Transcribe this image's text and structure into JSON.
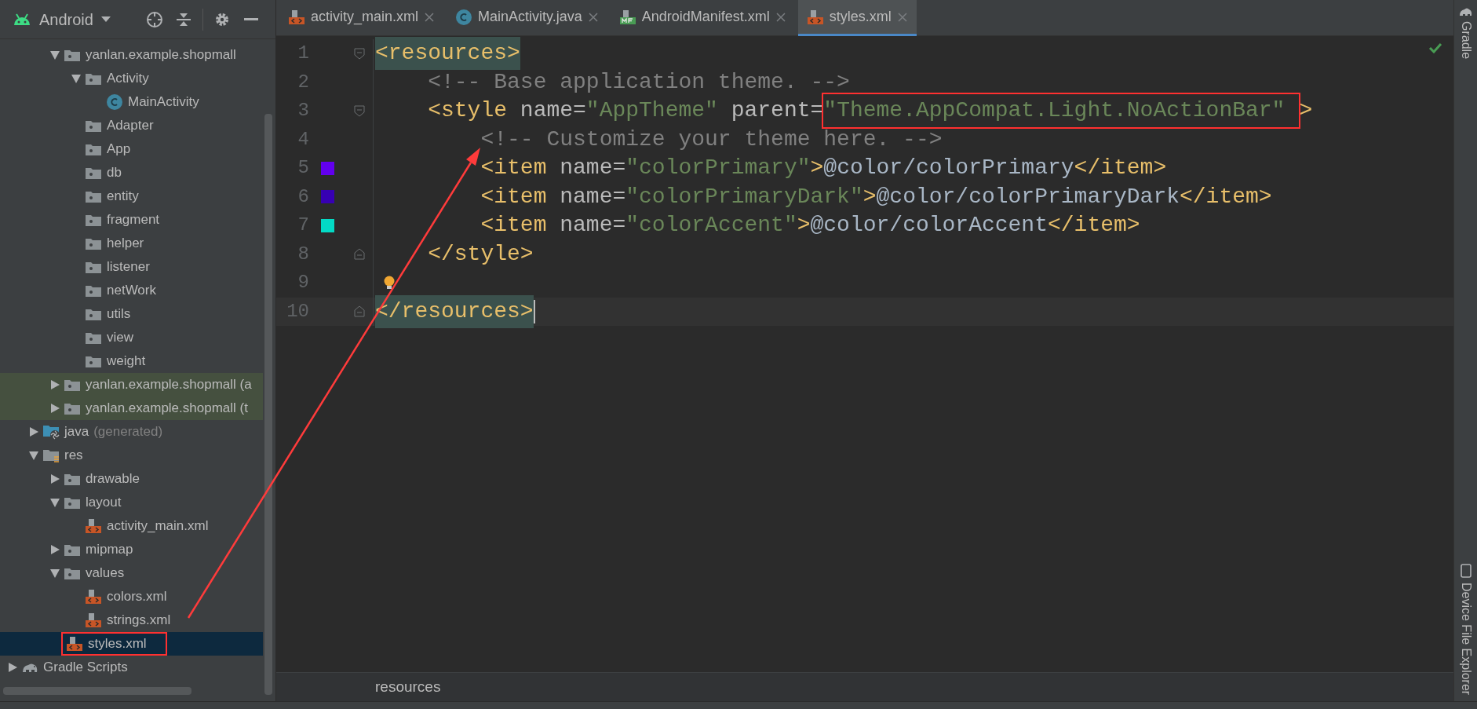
{
  "project_view": {
    "title": "Android"
  },
  "tree": [
    {
      "children": [
        {
          "children": [
            {
              "label": "yanlan.example.shopmall",
              "kind": "package",
              "expanded": true,
              "selected": false,
              "highlighted": false,
              "boxed": false,
              "children": [
                {
                  "label": "Activity",
                  "kind": "package",
                  "expanded": true,
                  "selected": false,
                  "highlighted": false,
                  "boxed": false,
                  "children": [
                    {
                      "label": "MainActivity",
                      "kind": "class",
                      "selected": false,
                      "highlighted": false,
                      "boxed": false
                    }
                  ]
                },
                {
                  "label": "Adapter",
                  "kind": "package",
                  "selected": false,
                  "highlighted": false,
                  "boxed": false
                },
                {
                  "label": "App",
                  "kind": "package",
                  "selected": false,
                  "highlighted": false,
                  "boxed": false
                },
                {
                  "label": "db",
                  "kind": "package",
                  "selected": false,
                  "highlighted": false,
                  "boxed": false
                },
                {
                  "label": "entity",
                  "kind": "package",
                  "selected": false,
                  "highlighted": false,
                  "boxed": false
                },
                {
                  "label": "fragment",
                  "kind": "package",
                  "selected": false,
                  "highlighted": false,
                  "boxed": false
                },
                {
                  "label": "helper",
                  "kind": "package",
                  "selected": false,
                  "highlighted": false,
                  "boxed": false
                },
                {
                  "label": "listener",
                  "kind": "package",
                  "selected": false,
                  "highlighted": false,
                  "boxed": false
                },
                {
                  "label": "netWork",
                  "kind": "package",
                  "selected": false,
                  "highlighted": false,
                  "boxed": false
                },
                {
                  "label": "utils",
                  "kind": "package",
                  "selected": false,
                  "highlighted": false,
                  "boxed": false
                },
                {
                  "label": "view",
                  "kind": "package",
                  "selected": false,
                  "highlighted": false,
                  "boxed": false
                },
                {
                  "label": "weight",
                  "kind": "package",
                  "selected": false,
                  "highlighted": false,
                  "boxed": false
                }
              ]
            },
            {
              "label": "yanlan.example.shopmall (a",
              "kind": "package",
              "expanded": false,
              "selected": false,
              "highlighted": true,
              "boxed": false
            },
            {
              "label": "yanlan.example.shopmall (t",
              "kind": "package",
              "expanded": false,
              "selected": false,
              "highlighted": true,
              "boxed": false
            }
          ]
        },
        {
          "label": "java",
          "suffix": "(generated)",
          "kind": "generated",
          "expanded": false,
          "selected": false,
          "highlighted": false,
          "boxed": false
        },
        {
          "label": "res",
          "kind": "resources",
          "expanded": true,
          "selected": false,
          "highlighted": false,
          "boxed": false,
          "children": [
            {
              "label": "drawable",
              "kind": "package",
              "expanded": false,
              "selected": false,
              "highlighted": false,
              "boxed": false
            },
            {
              "label": "layout",
              "kind": "package",
              "expanded": true,
              "selected": false,
              "highlighted": false,
              "boxed": false,
              "children": [
                {
                  "label": "activity_main.xml",
                  "kind": "xml",
                  "selected": false,
                  "highlighted": false,
                  "boxed": false
                }
              ]
            },
            {
              "label": "mipmap",
              "kind": "package",
              "expanded": false,
              "selected": false,
              "highlighted": false,
              "boxed": false
            },
            {
              "label": "values",
              "kind": "package",
              "expanded": true,
              "selected": false,
              "highlighted": false,
              "boxed": false,
              "children": [
                {
                  "label": "colors.xml",
                  "kind": "xml",
                  "selected": false,
                  "highlighted": false,
                  "boxed": false
                },
                {
                  "label": "strings.xml",
                  "kind": "xml",
                  "selected": false,
                  "highlighted": false,
                  "boxed": false
                },
                {
                  "label": "styles.xml",
                  "kind": "xml",
                  "selected": true,
                  "highlighted": false,
                  "boxed": true
                }
              ]
            }
          ]
        }
      ]
    },
    {
      "label": "Gradle Scripts",
      "kind": "gradle",
      "expanded": false,
      "selected": false,
      "highlighted": false,
      "boxed": false
    }
  ],
  "tabs": [
    {
      "label": "activity_main.xml",
      "kind": "xml",
      "selected": false
    },
    {
      "label": "MainActivity.java",
      "kind": "class",
      "selected": false
    },
    {
      "label": "AndroidManifest.xml",
      "kind": "manifest",
      "selected": false
    },
    {
      "label": "styles.xml",
      "kind": "xml",
      "selected": true
    }
  ],
  "lines": [
    {
      "number": "1",
      "fold_start": true,
      "current": false,
      "tokens": [
        {
          "kind": "tag-matched",
          "text": "<resources>"
        }
      ]
    },
    {
      "number": "2",
      "current": false,
      "tokens": [
        {
          "kind": "comment",
          "text": "    <!-- Base application theme. -->"
        }
      ]
    },
    {
      "number": "3",
      "fold_start": true,
      "current": false,
      "tokens": [
        {
          "kind": "tag",
          "text": "    <style"
        },
        {
          "kind": "attr",
          "text": " name"
        },
        {
          "kind": "attr",
          "text": "="
        },
        {
          "kind": "value",
          "text": "\"AppTheme\""
        },
        {
          "kind": "attr",
          "text": " parent"
        },
        {
          "kind": "attr",
          "text": "="
        },
        {
          "kind": "value",
          "text": "\"Theme.AppCompat.Light.NoActionBar\"",
          "boxed": true
        },
        {
          "kind": "tag",
          "text": ">"
        }
      ]
    },
    {
      "number": "4",
      "current": false,
      "tokens": [
        {
          "kind": "comment",
          "text": "        <!-- Customize your theme here. -->"
        }
      ]
    },
    {
      "number": "5",
      "color": "#6200ee",
      "current": false,
      "tokens": [
        {
          "kind": "tag",
          "text": "        <item"
        },
        {
          "kind": "attr",
          "text": " name"
        },
        {
          "kind": "attr",
          "text": "="
        },
        {
          "kind": "value",
          "text": "\"colorPrimary\""
        },
        {
          "kind": "tag",
          "text": ">"
        },
        {
          "kind": "text",
          "text": "@color/colorPrimary"
        },
        {
          "kind": "tag",
          "text": "</item>"
        }
      ]
    },
    {
      "number": "6",
      "color": "#3700b3",
      "current": false,
      "tokens": [
        {
          "kind": "tag",
          "text": "        <item"
        },
        {
          "kind": "attr",
          "text": " name"
        },
        {
          "kind": "attr",
          "text": "="
        },
        {
          "kind": "value",
          "text": "\"colorPrimaryDark\""
        },
        {
          "kind": "tag",
          "text": ">"
        },
        {
          "kind": "text",
          "text": "@color/colorPrimaryDark"
        },
        {
          "kind": "tag",
          "text": "</item>"
        }
      ]
    },
    {
      "number": "7",
      "color": "#03dac5",
      "current": false,
      "tokens": [
        {
          "kind": "tag",
          "text": "        <item"
        },
        {
          "kind": "attr",
          "text": " name"
        },
        {
          "kind": "attr",
          "text": "="
        },
        {
          "kind": "value",
          "text": "\"colorAccent\""
        },
        {
          "kind": "tag",
          "text": ">"
        },
        {
          "kind": "text",
          "text": "@color/colorAccent"
        },
        {
          "kind": "tag",
          "text": "</item>"
        }
      ]
    },
    {
      "number": "8",
      "fold_end": true,
      "current": false,
      "tokens": [
        {
          "kind": "tag",
          "text": "    </style>"
        }
      ]
    },
    {
      "number": "9",
      "bulb": true,
      "current": false
    },
    {
      "number": "10",
      "fold_end": true,
      "current": true,
      "tokens": [
        {
          "kind": "tag-matched",
          "text": "</resources>"
        }
      ]
    }
  ],
  "breadcrumb": "resources",
  "right_strip": [
    {
      "label": "Gradle",
      "kind": "gradle"
    },
    {
      "label": "Device File Explorer",
      "kind": "device"
    }
  ]
}
